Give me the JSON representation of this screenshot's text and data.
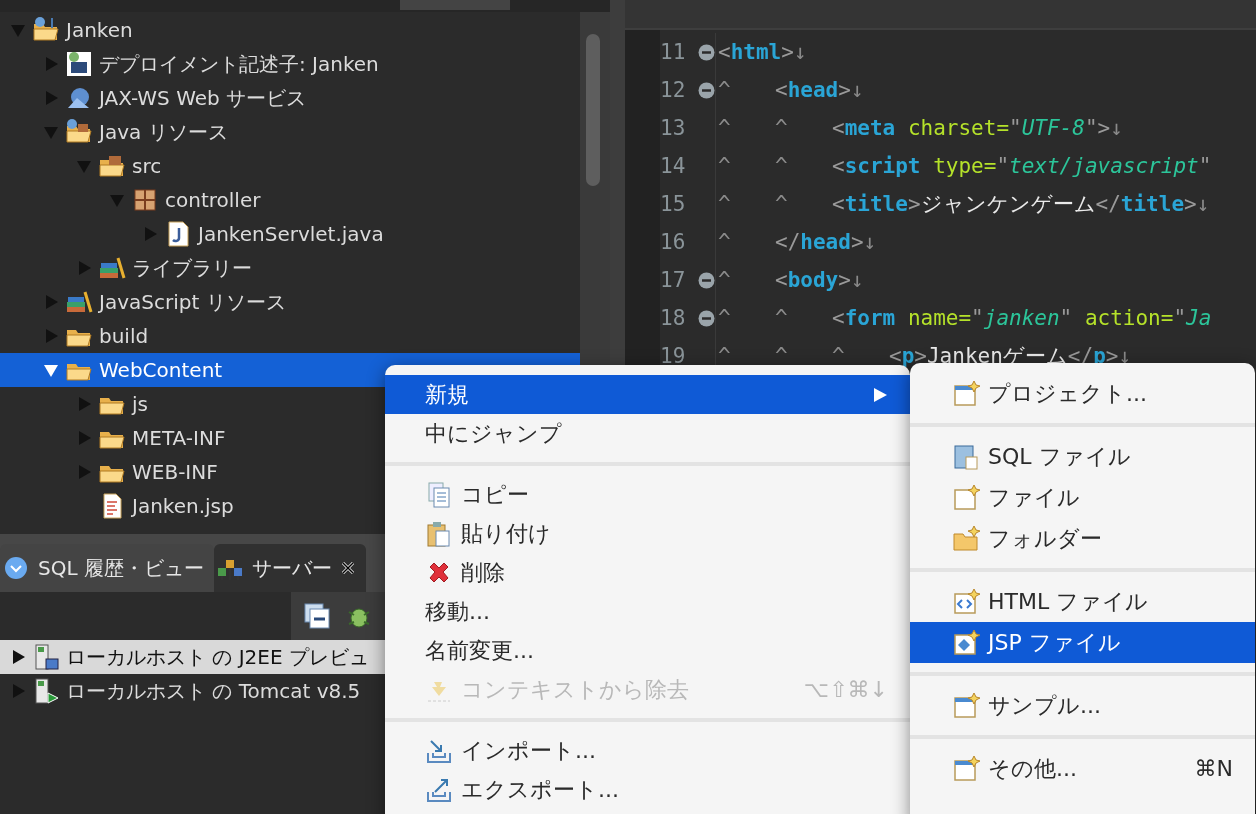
{
  "project_tree": [
    {
      "label": "Janken",
      "kind": "project",
      "expandable": true,
      "expanded": true,
      "selected": false,
      "children": [
        {
          "label": "デプロイメント記述子: Janken",
          "kind": "descriptor",
          "expandable": true,
          "expanded": false,
          "selected": false
        },
        {
          "label": "JAX-WS Web サービス",
          "kind": "webservice",
          "expandable": true,
          "expanded": false,
          "selected": false
        },
        {
          "label": "Java リソース",
          "kind": "java-resources",
          "expandable": true,
          "expanded": true,
          "selected": false,
          "children": [
            {
              "label": "src",
              "kind": "source-folder",
              "expandable": true,
              "expanded": true,
              "selected": false,
              "children": [
                {
                  "label": "controller",
                  "kind": "package",
                  "expandable": true,
                  "expanded": true,
                  "selected": false,
                  "children": [
                    {
                      "label": "JankenServlet.java",
                      "kind": "java-file",
                      "expandable": true,
                      "expanded": false,
                      "selected": false
                    }
                  ]
                }
              ]
            },
            {
              "label": "ライブラリー",
              "kind": "library",
              "expandable": true,
              "expanded": false,
              "selected": false
            }
          ]
        },
        {
          "label": "JavaScript リソース",
          "kind": "library",
          "expandable": true,
          "expanded": false,
          "selected": false
        },
        {
          "label": "build",
          "kind": "folder",
          "expandable": true,
          "expanded": false,
          "selected": false
        },
        {
          "label": "WebContent",
          "kind": "folder",
          "expandable": true,
          "expanded": true,
          "selected": true,
          "children": [
            {
              "label": "js",
              "kind": "folder",
              "expandable": true,
              "expanded": false,
              "selected": false
            },
            {
              "label": "META-INF",
              "kind": "folder",
              "expandable": true,
              "expanded": false,
              "selected": false
            },
            {
              "label": "WEB-INF",
              "kind": "folder",
              "expandable": true,
              "expanded": false,
              "selected": false
            },
            {
              "label": "Janken.jsp",
              "kind": "jsp-file",
              "expandable": false,
              "expanded": false,
              "selected": false
            }
          ]
        }
      ]
    }
  ],
  "bottom_panel": {
    "tabs": [
      {
        "label": "SQL 履歴・ビュー",
        "kind": "history",
        "selected": false,
        "closable": false
      },
      {
        "label": "サーバー",
        "kind": "servers",
        "selected": true,
        "closable": true
      }
    ],
    "servers": [
      {
        "label": "ローカルホスト の J2EE プレビュ",
        "kind": "preview",
        "selected": true
      },
      {
        "label": "ローカルホスト の Tomcat v8.5",
        "kind": "tomcat",
        "selected": false
      }
    ]
  },
  "editor": {
    "lines": [
      {
        "number": "11",
        "fold": true,
        "tokens": [
          {
            "kind": "punct",
            "text": "<"
          },
          {
            "kind": "tag",
            "text": "html"
          },
          {
            "kind": "punct",
            "text": ">"
          },
          {
            "kind": "eol",
            "text": "↓"
          }
        ]
      },
      {
        "number": "12",
        "fold": true,
        "tokens": [
          {
            "kind": "tab",
            "text": "^"
          },
          {
            "kind": "punct",
            "text": "<"
          },
          {
            "kind": "tag",
            "text": "head"
          },
          {
            "kind": "punct",
            "text": ">"
          },
          {
            "kind": "eol",
            "text": "↓"
          }
        ]
      },
      {
        "number": "13",
        "fold": false,
        "tokens": [
          {
            "kind": "tab",
            "text": "^"
          },
          {
            "kind": "tab",
            "text": "^"
          },
          {
            "kind": "punct",
            "text": "<"
          },
          {
            "kind": "tag",
            "text": "meta"
          },
          {
            "kind": "attr",
            "text": " charset="
          },
          {
            "kind": "punct",
            "text": "\""
          },
          {
            "kind": "string",
            "text": "UTF-8"
          },
          {
            "kind": "punct",
            "text": "\">"
          },
          {
            "kind": "eol",
            "text": "↓"
          }
        ]
      },
      {
        "number": "14",
        "fold": false,
        "tokens": [
          {
            "kind": "tab",
            "text": "^"
          },
          {
            "kind": "tab",
            "text": "^"
          },
          {
            "kind": "punct",
            "text": "<"
          },
          {
            "kind": "tag",
            "text": "script"
          },
          {
            "kind": "attr",
            "text": " type="
          },
          {
            "kind": "punct",
            "text": "\""
          },
          {
            "kind": "string",
            "text": "text/javascript"
          },
          {
            "kind": "punct",
            "text": "\""
          }
        ]
      },
      {
        "number": "15",
        "fold": false,
        "tokens": [
          {
            "kind": "tab",
            "text": "^"
          },
          {
            "kind": "tab",
            "text": "^"
          },
          {
            "kind": "punct",
            "text": "<"
          },
          {
            "kind": "tag",
            "text": "title"
          },
          {
            "kind": "punct",
            "text": ">"
          },
          {
            "kind": "text",
            "text": "ジャンケンゲーム"
          },
          {
            "kind": "punct",
            "text": "</"
          },
          {
            "kind": "tag",
            "text": "title"
          },
          {
            "kind": "punct",
            "text": ">"
          },
          {
            "kind": "eol",
            "text": "↓"
          }
        ]
      },
      {
        "number": "16",
        "fold": false,
        "tokens": [
          {
            "kind": "tab",
            "text": "^"
          },
          {
            "kind": "punct",
            "text": "</"
          },
          {
            "kind": "tag",
            "text": "head"
          },
          {
            "kind": "punct",
            "text": ">"
          },
          {
            "kind": "eol",
            "text": "↓"
          }
        ]
      },
      {
        "number": "17",
        "fold": true,
        "tokens": [
          {
            "kind": "tab",
            "text": "^"
          },
          {
            "kind": "punct",
            "text": "<"
          },
          {
            "kind": "tag",
            "text": "body"
          },
          {
            "kind": "punct",
            "text": ">"
          },
          {
            "kind": "eol",
            "text": "↓"
          }
        ]
      },
      {
        "number": "18",
        "fold": true,
        "tokens": [
          {
            "kind": "tab",
            "text": "^"
          },
          {
            "kind": "tab",
            "text": "^"
          },
          {
            "kind": "punct",
            "text": "<"
          },
          {
            "kind": "tag",
            "text": "form"
          },
          {
            "kind": "attr",
            "text": " name="
          },
          {
            "kind": "punct",
            "text": "\""
          },
          {
            "kind": "string",
            "text": "janken"
          },
          {
            "kind": "punct",
            "text": "\""
          },
          {
            "kind": "attr",
            "text": " action="
          },
          {
            "kind": "punct",
            "text": "\""
          },
          {
            "kind": "string",
            "text": "Ja"
          }
        ]
      },
      {
        "number": "19",
        "fold": false,
        "tokens": [
          {
            "kind": "tab",
            "text": "^"
          },
          {
            "kind": "tab",
            "text": "^"
          },
          {
            "kind": "tab",
            "text": "^"
          },
          {
            "kind": "punct",
            "text": "<"
          },
          {
            "kind": "tag",
            "text": "p"
          },
          {
            "kind": "punct",
            "text": ">"
          },
          {
            "kind": "text",
            "text": "Jankenゲーム"
          },
          {
            "kind": "punct",
            "text": "</"
          },
          {
            "kind": "tag",
            "text": "p"
          },
          {
            "kind": "punct",
            "text": ">"
          },
          {
            "kind": "eol",
            "text": "↓"
          }
        ]
      }
    ]
  },
  "context_menu": {
    "items": [
      {
        "kind": "item",
        "label": "新規",
        "selected": true,
        "disabled": false,
        "submenu": true
      },
      {
        "kind": "item",
        "label": "中にジャンプ",
        "selected": false,
        "disabled": false,
        "submenu": false
      },
      {
        "kind": "separator"
      },
      {
        "kind": "item",
        "label": "コピー",
        "selected": false,
        "disabled": false,
        "submenu": false
      },
      {
        "kind": "item",
        "label": "貼り付け",
        "selected": false,
        "disabled": false,
        "submenu": false
      },
      {
        "kind": "item",
        "label": "削除",
        "selected": false,
        "disabled": false,
        "submenu": false
      },
      {
        "kind": "item",
        "label": "移動...",
        "selected": false,
        "disabled": false,
        "submenu": false
      },
      {
        "kind": "item",
        "label": "名前変更...",
        "selected": false,
        "disabled": false,
        "submenu": false
      },
      {
        "kind": "item",
        "label": "コンテキストから除去",
        "shortcut": "⌥⇧⌘↓",
        "selected": false,
        "disabled": true,
        "submenu": false
      },
      {
        "kind": "separator"
      },
      {
        "kind": "item",
        "label": "インポート...",
        "selected": false,
        "disabled": false,
        "submenu": false
      },
      {
        "kind": "item",
        "label": "エクスポート...",
        "selected": false,
        "disabled": false,
        "submenu": false
      }
    ]
  },
  "submenu": {
    "items": [
      {
        "kind": "item",
        "label": "プロジェクト...",
        "selected": false
      },
      {
        "kind": "separator"
      },
      {
        "kind": "item",
        "label": "SQL ファイル",
        "selected": false
      },
      {
        "kind": "item",
        "label": "ファイル",
        "selected": false
      },
      {
        "kind": "item",
        "label": "フォルダー",
        "selected": false
      },
      {
        "kind": "separator"
      },
      {
        "kind": "item",
        "label": "HTML ファイル",
        "selected": false
      },
      {
        "kind": "item",
        "label": "JSP ファイル",
        "selected": true
      },
      {
        "kind": "separator"
      },
      {
        "kind": "item",
        "label": "サンプル...",
        "selected": false
      },
      {
        "kind": "separator"
      },
      {
        "kind": "item",
        "label": "その他...",
        "shortcut": "⌘N",
        "selected": false
      }
    ]
  }
}
